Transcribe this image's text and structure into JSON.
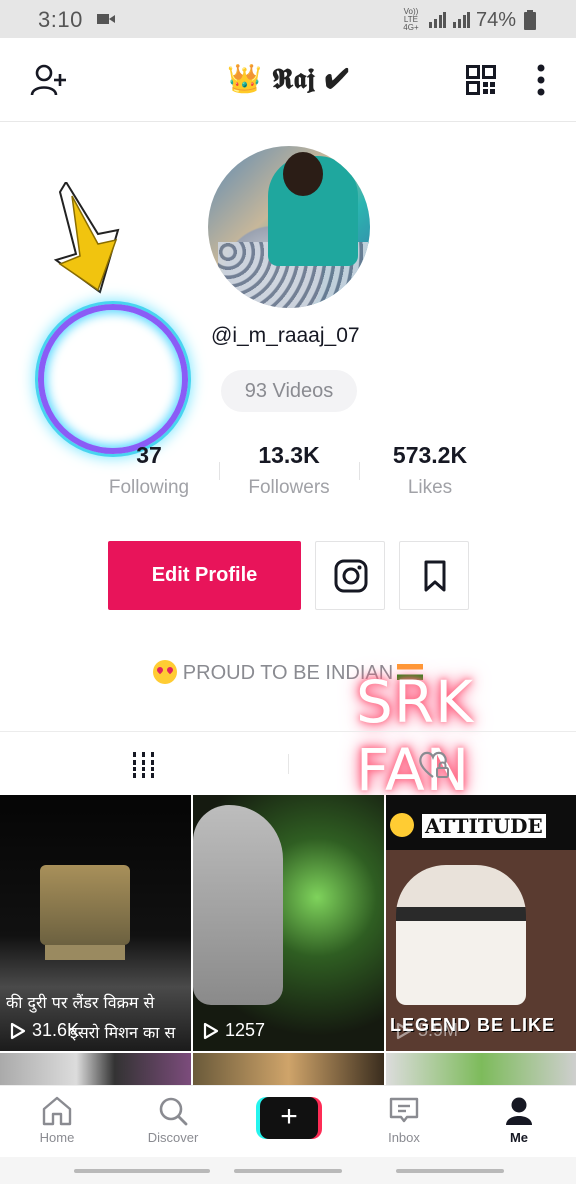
{
  "status_bar": {
    "time": "3:10",
    "network": "Vo)) LTE 4G+",
    "battery": "74%"
  },
  "header": {
    "title": "👑 𝕽𝖆𝖏 ✔"
  },
  "profile": {
    "username": "@i_m_raaaj_07",
    "videos_badge": "93 Videos",
    "stats": [
      {
        "value": "37",
        "label": "Following"
      },
      {
        "value": "13.3K",
        "label": "Followers"
      },
      {
        "value": "573.2K",
        "label": "Likes"
      }
    ],
    "edit_button": "Edit Profile",
    "bio": "PROUD TO BE INDIAN",
    "overlay_text": "SRK FAN"
  },
  "videos": [
    {
      "caption_line1": "की दुरी पर लैंडर विक्रम से",
      "caption_line2": "इसरो मिशन का स",
      "play_count": "31.6K"
    },
    {
      "play_count": "1257"
    },
    {
      "banner": "ATTITUDE",
      "caption": "LEGEND BE LIKE",
      "play_count": "5.9M"
    }
  ],
  "bottom_nav": {
    "home": "Home",
    "discover": "Discover",
    "create": "+",
    "inbox": "Inbox",
    "me": "Me"
  },
  "colors": {
    "accent": "#e8145a",
    "ring_outer": "#48d4f0",
    "ring_inner": "#8a5cf6"
  }
}
